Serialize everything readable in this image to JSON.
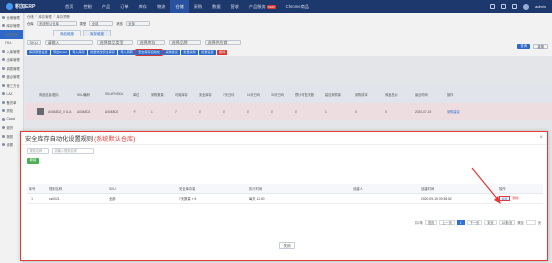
{
  "app": {
    "logo_text": "积加ERP"
  },
  "nav": {
    "items": [
      "首页",
      "控制",
      "产品",
      "订单",
      "库存",
      "物流",
      "仓储",
      "采购",
      "数据",
      "营收",
      "产品服务",
      "Chrome商品"
    ],
    "active_index": 6,
    "hot_badge": "NEW",
    "username": "admin"
  },
  "sidebar": {
    "items": [
      {
        "label": "仓储管理",
        "type": "section"
      },
      {
        "label": "库存管理",
        "type": "section"
      },
      {
        "label": "库存预警",
        "type": "sub-active"
      },
      {
        "label": "FBA",
        "type": "sub"
      },
      {
        "label": "入库管理",
        "type": "section"
      },
      {
        "label": "出库管理",
        "type": "section"
      },
      {
        "label": "调拨管理",
        "type": "section"
      },
      {
        "label": "盘点管理",
        "type": "section"
      },
      {
        "label": "第三方仓",
        "type": "section"
      },
      {
        "label": "LAZ",
        "type": "section"
      },
      {
        "label": "备货单",
        "type": "section"
      },
      {
        "label": "质检",
        "type": "section"
      },
      {
        "label": "Cloud",
        "type": "section"
      },
      {
        "label": "退货",
        "type": "section"
      },
      {
        "label": "报损",
        "type": "section"
      },
      {
        "label": "设置",
        "type": "section"
      }
    ]
  },
  "breadcrumb": [
    "仓储",
    "库存管理",
    "库存预警"
  ],
  "filters": {
    "warehouse_label": "仓库",
    "warehouse_value": "系统默认仓库",
    "type_label": "类型",
    "type_value": "全部",
    "status_label": "状态",
    "status_value": "全部"
  },
  "tabs": [
    {
      "label": "商品维度"
    },
    {
      "label": "库存维度"
    }
  ],
  "filters2": [
    "SKU",
    "请输入",
    "选择商品类型",
    "选择库存",
    "选择品牌",
    "选择供应商"
  ],
  "search_button": "查询",
  "reset_button": "重置",
  "toolbar": [
    "库存预警设置",
    "导出Excel",
    "导入库存",
    "批量修改安全库存",
    "导入周转",
    "安全库存自动化",
    "采购建议",
    "批量采购",
    "批量设置",
    "删除"
  ],
  "grid": {
    "headers": [
      "商品信息/图片",
      "SKU编码",
      "SKU/FNSKU",
      "单位",
      "采购数量",
      "可用库存",
      "安全库存",
      "7天日均",
      "14天日均",
      "30天日均",
      "预计可售天数",
      "建议采购量",
      "采购成本",
      "商品总价",
      "最近时间",
      "操作"
    ],
    "row": {
      "name": "A0048D2_0 G-A",
      "sku": "A0048D2",
      "unit": "个",
      "qty": "1",
      "available": "7",
      "safety": "0",
      "avg7": "0",
      "avg14": "0",
      "avg30": "0",
      "days": "0",
      "suggest": "1",
      "cost": "0",
      "total": "0",
      "date": "2020-07-15",
      "op1": "采购建议",
      "op2": "详情"
    }
  },
  "modal": {
    "title": "安全库存自动化设置规则",
    "subtitle": "(系统默认仓库)",
    "filter1": "规则名称",
    "filter2": "请输入规则名称",
    "add_button": "新增",
    "headers": [
      "序号",
      "规则名称",
      "SKU",
      "安全库存量",
      "执行时间",
      "",
      "创建人",
      "创建时间",
      "操作"
    ],
    "rows": [
      {
        "index": "1",
        "name": "cs0021",
        "sku": "全部",
        "safety": "7天数量 × 5",
        "exec": "每天 11:00",
        "creator": "",
        "created": "2020-09-15 09:38:52",
        "edit": "编辑",
        "delete": "删除"
      }
    ],
    "pager": {
      "total": "共1条",
      "first": "首页",
      "prev": "上一页",
      "current": "1",
      "next": "下一页",
      "last": "末页",
      "size": "10条/页",
      "goto": "跳至",
      "page_unit": "页"
    },
    "close_button": "关闭"
  },
  "colors": {
    "nav_bg": "#1f3b73",
    "primary": "#2f6fd6",
    "highlight": "#e53935",
    "success": "#4caf50"
  }
}
